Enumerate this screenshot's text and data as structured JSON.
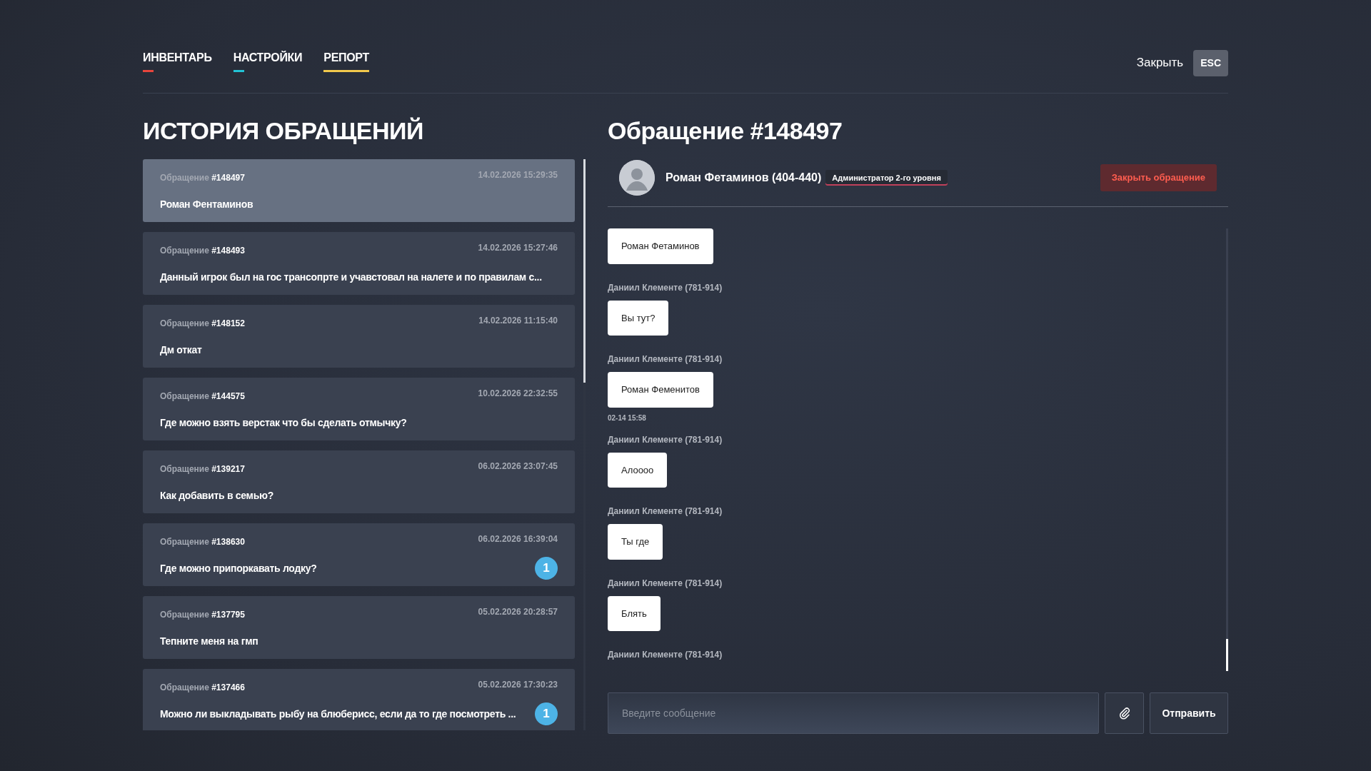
{
  "tabs": [
    {
      "label": "ИНВЕНТАРЬ",
      "selected": false,
      "color": "#e8453c"
    },
    {
      "label": "НАСТРОЙКИ",
      "selected": false,
      "color": "#22c3d6"
    },
    {
      "label": "РЕПОРТ",
      "selected": true,
      "color": "#f2c94c"
    }
  ],
  "close": {
    "label": "Закрыть",
    "key": "ESC"
  },
  "history": {
    "title": "ИСТОРИЯ ОБРАЩЕНИЙ",
    "items": [
      {
        "prefix": "Обращение",
        "number": "#148497",
        "date": "14.02.2026 15:29:35",
        "text": "Роман Фентаминов",
        "selected": true
      },
      {
        "prefix": "Обращение",
        "number": "#148493",
        "date": "14.02.2026 15:27:46",
        "text": "Данный игрок был на гос трансопрте и учавстовал на налете и по правилам с...",
        "selected": false
      },
      {
        "prefix": "Обращение",
        "number": "#148152",
        "date": "14.02.2026 11:15:40",
        "text": "Дм откат",
        "selected": false
      },
      {
        "prefix": "Обращение",
        "number": "#144575",
        "date": "10.02.2026 22:32:55",
        "text": "Где можно взять верстак что бы сделать отмычку?",
        "selected": false
      },
      {
        "prefix": "Обращение",
        "number": "#139217",
        "date": "06.02.2026 23:07:45",
        "text": "Как добавить в семью?",
        "selected": false
      },
      {
        "prefix": "Обращение",
        "number": "#138630",
        "date": "06.02.2026 16:39:04",
        "text": "Где можно припоркавать лодку?",
        "selected": false,
        "unread": "1"
      },
      {
        "prefix": "Обращение",
        "number": "#137795",
        "date": "05.02.2026 20:28:57",
        "text": "Тепните меня на гмп",
        "selected": false
      },
      {
        "prefix": "Обращение",
        "number": "#137466",
        "date": "05.02.2026 17:30:23",
        "text": "Можно ли выкладывать рыбу на блюберисс, если да то где посмотреть ...",
        "selected": false,
        "unread": "1"
      }
    ]
  },
  "ticket": {
    "title": "Обращение #148497",
    "user": "Роман Фетаминов (404-440)",
    "role": "Администратор 2-го уровня",
    "close_button": "Закрыть обращение",
    "messages": [
      {
        "text": "Роман Фетаминов"
      },
      {
        "author": "Даниил Клементе (781-914)",
        "text": "Вы тут?"
      },
      {
        "author": "Даниил Клементе (781-914)",
        "text": "Роман Феменитов",
        "time": "02-14 15:58"
      },
      {
        "author": "Даниил Клементе (781-914)",
        "text": "Алоooo"
      },
      {
        "author": "Даниил Клементе (781-914)",
        "text": "Ты где"
      },
      {
        "author": "Даниил Клементе (781-914)",
        "text": "Блять"
      },
      {
        "author": "Даниил Клементе (781-914)"
      }
    ],
    "input": {
      "placeholder": "Введите сообщение"
    },
    "send": "Отправить"
  }
}
